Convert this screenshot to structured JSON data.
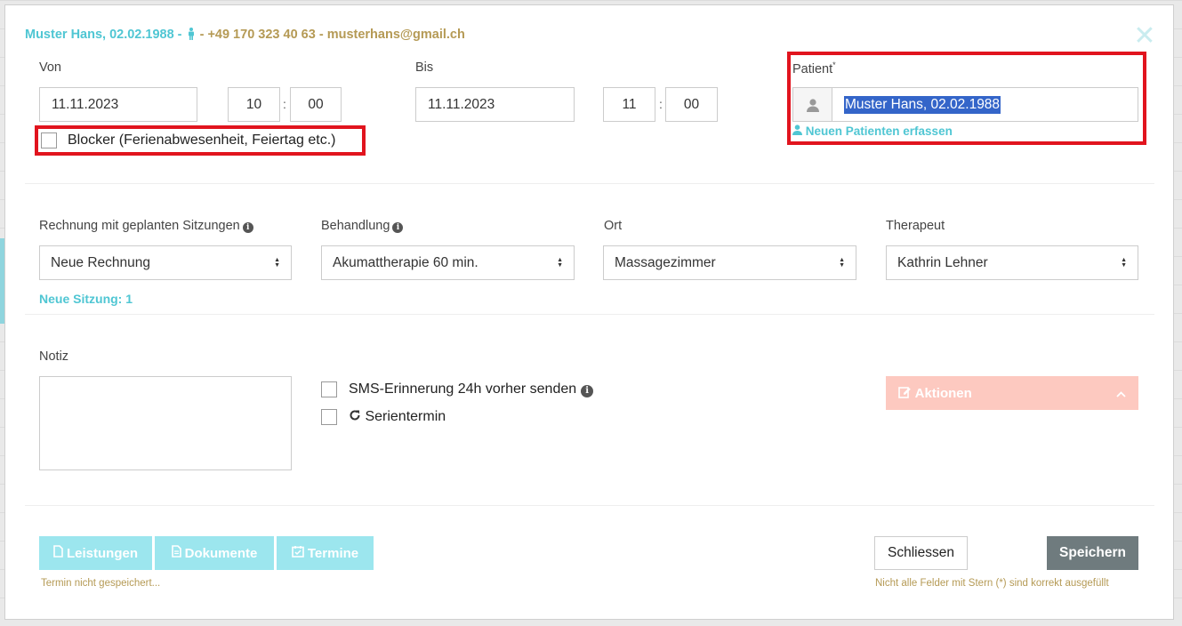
{
  "header": {
    "patient_name": "Muster Hans, 02.02.1988",
    "separator1": " - ",
    "separator2": " - ",
    "phone": "+49 170 323 40 63",
    "separator3": " - ",
    "email": "musterhans@gmail.ch",
    "close_label": "✕"
  },
  "von": {
    "label": "Von",
    "date": "11.11.2023",
    "hour": "10",
    "colon": ":",
    "minute": "00"
  },
  "bis": {
    "label": "Bis",
    "date": "11.11.2023",
    "hour": "11",
    "colon": ":",
    "minute": "00"
  },
  "blocker": {
    "label": "Blocker (Ferienabwesenheit, Feiertag etc.)",
    "checked": false
  },
  "patient": {
    "label": "Patient",
    "required_mark": "*",
    "value": "Muster Hans, 02.02.1988",
    "new_patient_link": "Neuen Patienten erfassen"
  },
  "rechnung": {
    "label": "Rechnung mit geplanten Sitzungen",
    "value": "Neue Rechnung",
    "new_session_note": "Neue Sitzung: 1"
  },
  "behandlung": {
    "label": "Behandlung",
    "value": "Akumattherapie 60 min."
  },
  "ort": {
    "label": "Ort",
    "value": "Massagezimmer"
  },
  "therapeut": {
    "label": "Therapeut",
    "value": "Kathrin Lehner"
  },
  "notiz": {
    "label": "Notiz",
    "value": ""
  },
  "options": {
    "sms_label": "SMS-Erinnerung 24h vorher senden",
    "serie_label": "Serientermin"
  },
  "actions": {
    "label": "Aktionen"
  },
  "footer": {
    "leistungen": "Leistungen",
    "dokumente": "Dokumente",
    "termine": "Termine",
    "not_saved_note": "Termin nicht gespeichert...",
    "close_button": "Schliessen",
    "save_button": "Speichern",
    "required_note": "Nicht alle Felder mit Stern (*) sind korrekt ausgefüllt"
  },
  "colors": {
    "teal": "#4fc6d3",
    "gold": "#b59a55",
    "highlight_red": "#e1141e",
    "save_button": "#6f7b7e",
    "aktionen_button": "#fdc9c0",
    "teal_button": "#9ce6ee"
  }
}
